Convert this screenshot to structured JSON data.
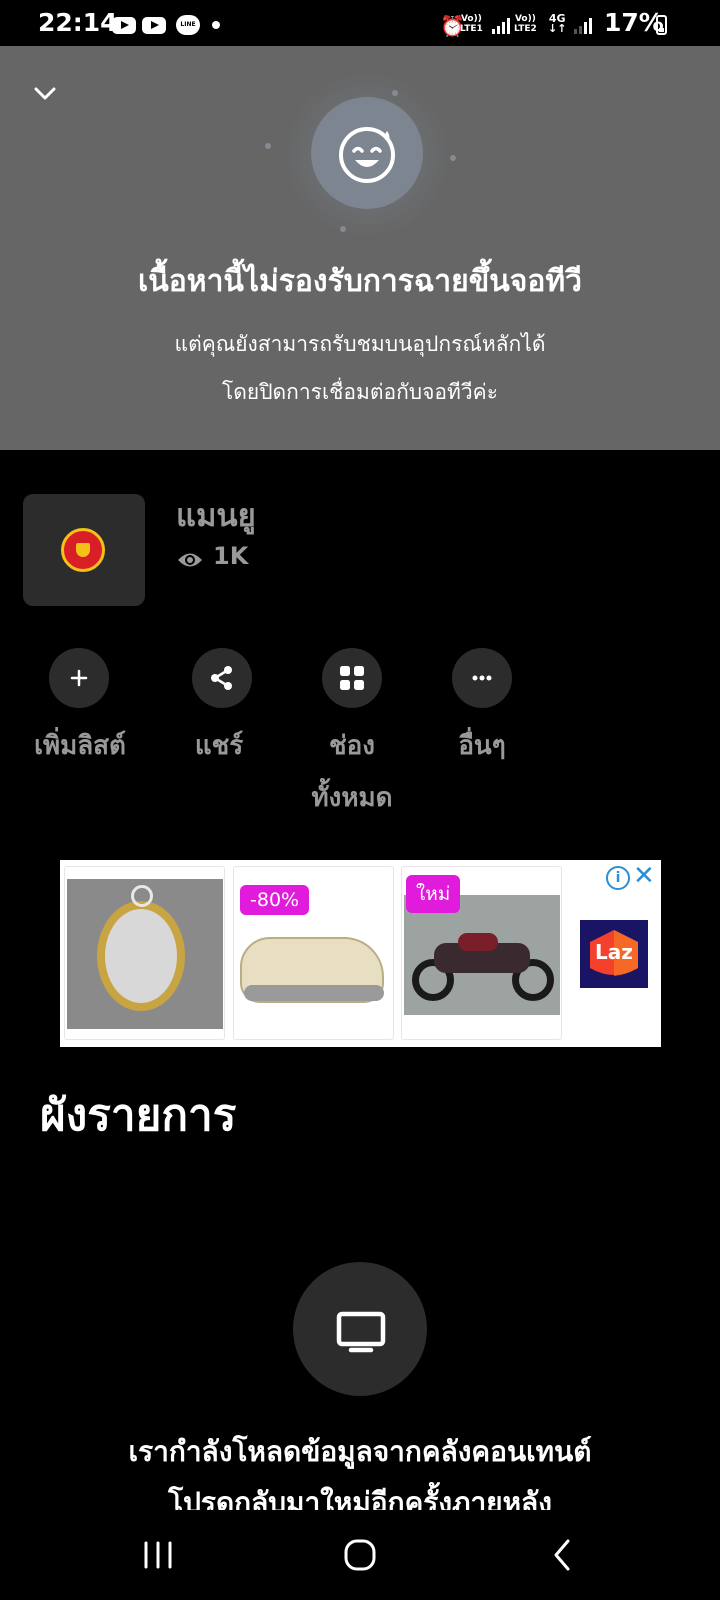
{
  "status_bar": {
    "time": "22:14",
    "sim1_label_top": "Vo))",
    "sim1_label_bottom": "LTE1",
    "sim2_label_top": "Vo))",
    "sim2_label_bottom": "LTE2",
    "network": "4G",
    "battery": "17%",
    "icons": [
      "youtube-icon",
      "youtube-icon",
      "line-icon",
      "notification-dot",
      "alarm-icon",
      "signal-icon",
      "battery-icon"
    ]
  },
  "cast_panel": {
    "title": "เนื้อหานี้ไม่รองรับการฉายขึ้นจอทีวี",
    "line1": "แต่คุณยังสามารถรับชมบนอุปกรณ์หลักได้",
    "line2": "โดยปิดการเชื่อมต่อกับจอทีวีค่ะ"
  },
  "video": {
    "title": "แมนยู",
    "views": "1K"
  },
  "actions": [
    {
      "label": "เพิ่มลิสต์",
      "icon": "plus-icon"
    },
    {
      "label": "แชร์",
      "icon": "share-icon"
    },
    {
      "label_line1": "ช่อง",
      "label_line2": "ทั้งหมด",
      "icon": "grid-icon"
    },
    {
      "label": "อื่นๆ",
      "icon": "more-icon"
    }
  ],
  "ad": {
    "badge_discount": "-80%",
    "badge_new": "ใหม่",
    "brand": "Laz",
    "info_glyph": "i",
    "close_glyph": "✕"
  },
  "section": {
    "title": "ผังรายการ"
  },
  "loading": {
    "line1": "เรากำลังโหลดข้อมูลจากคลังคอนเทนต์",
    "line2": "โปรดกลับมาใหม่อีกครั้งภายหลัง"
  },
  "colors": {
    "panel_bg": "#666666",
    "page_bg": "#000000",
    "button_bg": "#2c2c2c",
    "muted_text": "#999999",
    "ad_tag": "#e01bdc",
    "ad_icon": "#2a8fd4"
  }
}
